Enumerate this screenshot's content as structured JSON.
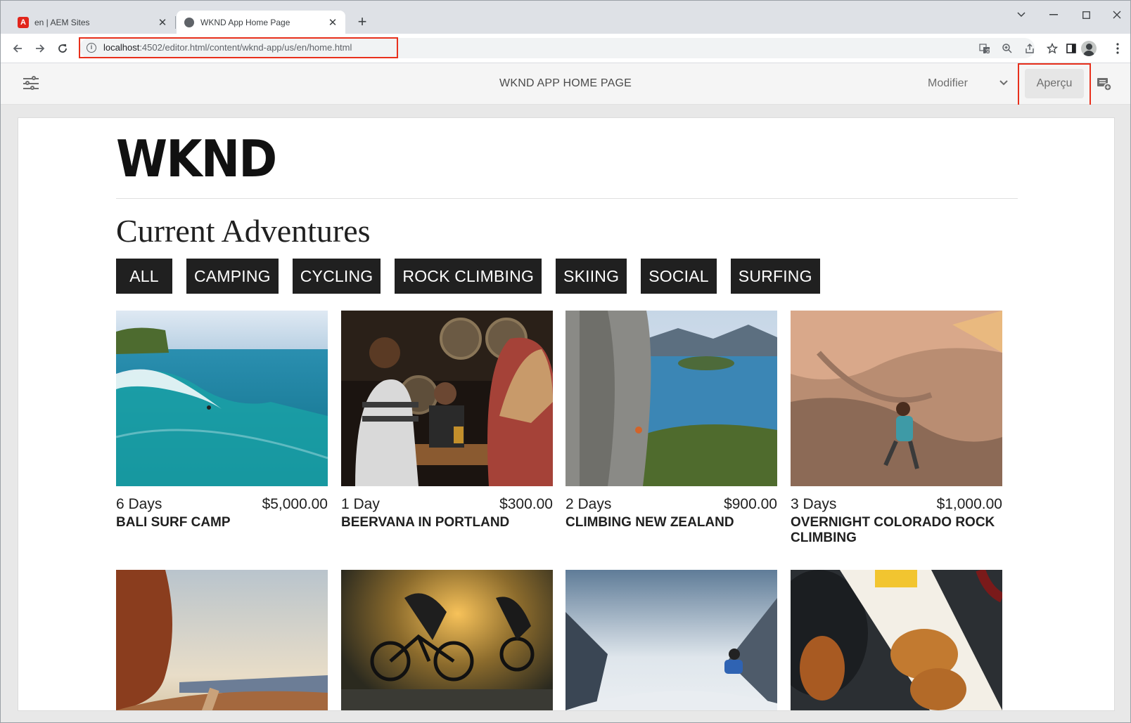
{
  "browser": {
    "tabs": [
      {
        "title": "en | AEM Sites",
        "icon": "adobe-icon"
      },
      {
        "title": "WKND App Home Page",
        "icon": "globe-icon"
      }
    ],
    "url_host": "localhost",
    "url_path": ":4502/editor.html/content/wknd-app/us/en/home.html"
  },
  "editor": {
    "title": "WKND APP HOME PAGE",
    "mode": "Modifier",
    "preview_label": "Aperçu"
  },
  "page": {
    "logo": "WKND",
    "section_title": "Current Adventures",
    "filters": [
      "ALL",
      "CAMPING",
      "CYCLING",
      "ROCK CLIMBING",
      "SKIING",
      "SOCIAL",
      "SURFING"
    ],
    "adventures": [
      {
        "days": "6 Days",
        "price": "$5,000.00",
        "name": "BALI SURF CAMP"
      },
      {
        "days": "1 Day",
        "price": "$300.00",
        "name": "BEERVANA IN PORTLAND"
      },
      {
        "days": "2 Days",
        "price": "$900.00",
        "name": "CLIMBING NEW ZEALAND"
      },
      {
        "days": "3 Days",
        "price": "$1,000.00",
        "name": "OVERNIGHT COLORADO ROCK CLIMBING"
      }
    ]
  },
  "colors": {
    "highlight": "#e8301c",
    "filter_bg": "#202020"
  }
}
